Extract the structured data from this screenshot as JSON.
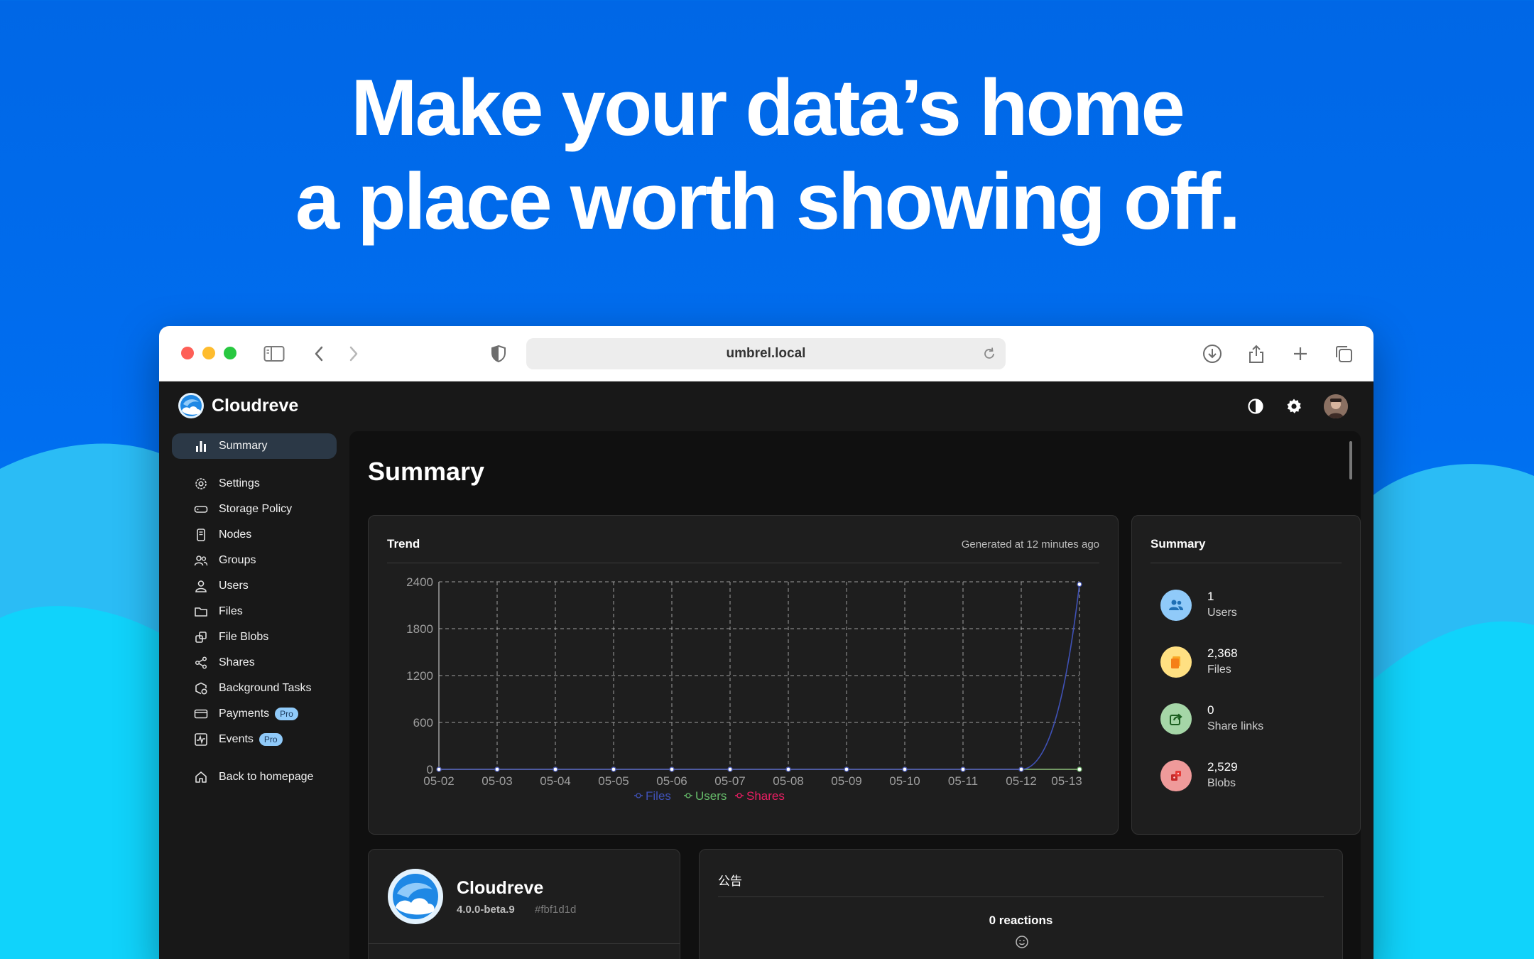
{
  "hero": {
    "line1": "Make your data’s home",
    "line2": "a place worth showing off."
  },
  "browser": {
    "url": "umbrel.local",
    "icons": [
      "sidebar-toggle-icon",
      "back-icon",
      "forward-icon",
      "shield-icon",
      "reload-icon",
      "download-icon",
      "share-icon",
      "new-tab-icon",
      "tabs-overview-icon"
    ]
  },
  "app": {
    "brand": "Cloudreve",
    "header_icons": [
      "theme-toggle-icon",
      "gear-icon",
      "avatar"
    ]
  },
  "sidebar": {
    "items": [
      {
        "label": "Summary",
        "icon": "bar-chart-icon",
        "active": true
      },
      {
        "label": "Settings",
        "icon": "gear-icon"
      },
      {
        "label": "Storage Policy",
        "icon": "storage-icon"
      },
      {
        "label": "Nodes",
        "icon": "node-icon"
      },
      {
        "label": "Groups",
        "icon": "groups-icon"
      },
      {
        "label": "Users",
        "icon": "user-icon"
      },
      {
        "label": "Files",
        "icon": "folder-icon"
      },
      {
        "label": "File Blobs",
        "icon": "blobs-icon"
      },
      {
        "label": "Shares",
        "icon": "share-nodes-icon"
      },
      {
        "label": "Background Tasks",
        "icon": "tasks-icon"
      },
      {
        "label": "Payments",
        "icon": "card-icon",
        "badge": "Pro"
      },
      {
        "label": "Events",
        "icon": "activity-icon",
        "badge": "Pro"
      },
      {
        "label": "Back to homepage",
        "icon": "home-icon"
      }
    ]
  },
  "main": {
    "title": "Summary",
    "trend": {
      "title": "Trend",
      "generated": "Generated at 12 minutes ago"
    },
    "summary": {
      "title": "Summary",
      "stats": [
        {
          "value": "1",
          "label": "Users",
          "color": "#90caf9",
          "icon": "users-icon"
        },
        {
          "value": "2,368",
          "label": "Files",
          "color": "#ffe082",
          "icon": "file-icon"
        },
        {
          "value": "0",
          "label": "Share links",
          "color": "#a5d6a7",
          "icon": "share-link-icon"
        },
        {
          "value": "2,529",
          "label": "Blobs",
          "color": "#ef9a9a",
          "icon": "blob-icon"
        }
      ]
    },
    "version": {
      "name": "Cloudreve",
      "version": "4.0.0-beta.9",
      "hash": "#fbf1d1d"
    },
    "notice": {
      "title": "公告",
      "reactions": "0 reactions"
    }
  },
  "chart_data": {
    "type": "line",
    "title": "Trend",
    "x": [
      "05-02",
      "05-03",
      "05-04",
      "05-05",
      "05-06",
      "05-07",
      "05-08",
      "05-09",
      "05-10",
      "05-11",
      "05-12",
      "05-13"
    ],
    "series": [
      {
        "name": "Files",
        "color": "#3f51b5",
        "values": [
          0,
          0,
          0,
          0,
          0,
          0,
          0,
          0,
          0,
          0,
          0,
          2368
        ]
      },
      {
        "name": "Users",
        "color": "#66bb6a",
        "values": [
          0,
          0,
          0,
          0,
          0,
          0,
          0,
          0,
          0,
          0,
          0,
          0
        ]
      },
      {
        "name": "Shares",
        "color": "#e91e63",
        "values": [
          0,
          0,
          0,
          0,
          0,
          0,
          0,
          0,
          0,
          0,
          0,
          0
        ]
      }
    ],
    "yticks": [
      0,
      600,
      1200,
      1800,
      2400
    ],
    "ylim": [
      0,
      2400
    ],
    "grid": true,
    "legend": "bottom"
  }
}
